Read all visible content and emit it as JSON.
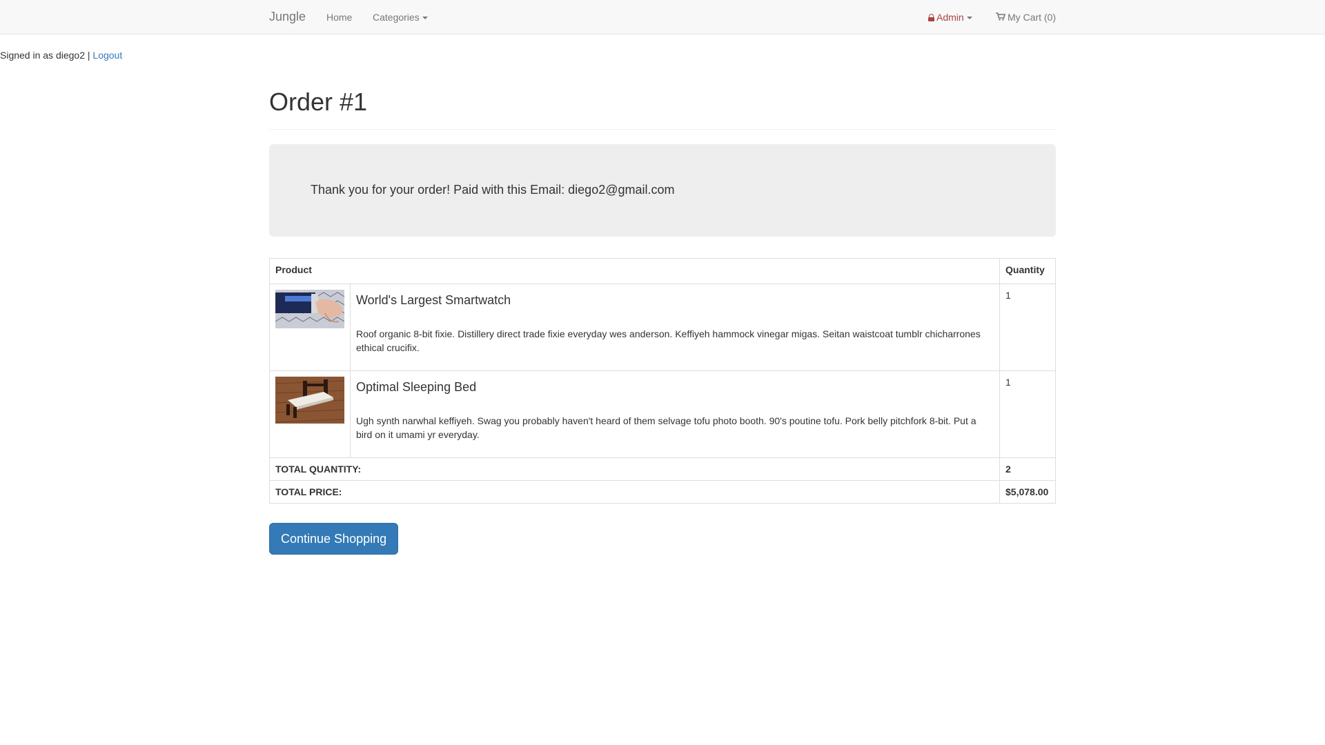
{
  "nav": {
    "brand": "Jungle",
    "home": "Home",
    "categories": "Categories",
    "admin": "Admin",
    "cart": "My Cart (0)"
  },
  "session": {
    "signed_in": "Signed in as diego2 |",
    "logout": "Logout"
  },
  "page": {
    "title": "Order #1",
    "thank_you": "Thank you for your order! Paid with this Email: diego2@gmail.com"
  },
  "table": {
    "headers": [
      "Product",
      "Quantity"
    ],
    "rows": [
      {
        "name": "World's Largest Smartwatch",
        "description": "Roof organic 8-bit fixie. Distillery direct trade fixie everyday wes anderson. Keffiyeh hammock vinegar migas. Seitan waistcoat tumblr chicharrones ethical crucifix.",
        "quantity": "1"
      },
      {
        "name": "Optimal Sleeping Bed",
        "description": "Ugh synth narwhal keffiyeh. Swag you probably haven't heard of them selvage tofu photo booth. 90's poutine tofu. Pork belly pitchfork 8-bit. Put a bird on it umami yr everyday.",
        "quantity": "1"
      }
    ],
    "total_quantity_label": "TOTAL QUANTITY:",
    "total_quantity": "2",
    "total_price_label": "TOTAL PRICE:",
    "total_price": "$5,078.00"
  },
  "actions": {
    "continue": "Continue Shopping"
  },
  "colors": {
    "link": "#337ab7",
    "admin": "#a94442",
    "button": "#337ab7"
  },
  "icons": [
    "lock-icon",
    "cart-icon",
    "caret-down-icon"
  ]
}
